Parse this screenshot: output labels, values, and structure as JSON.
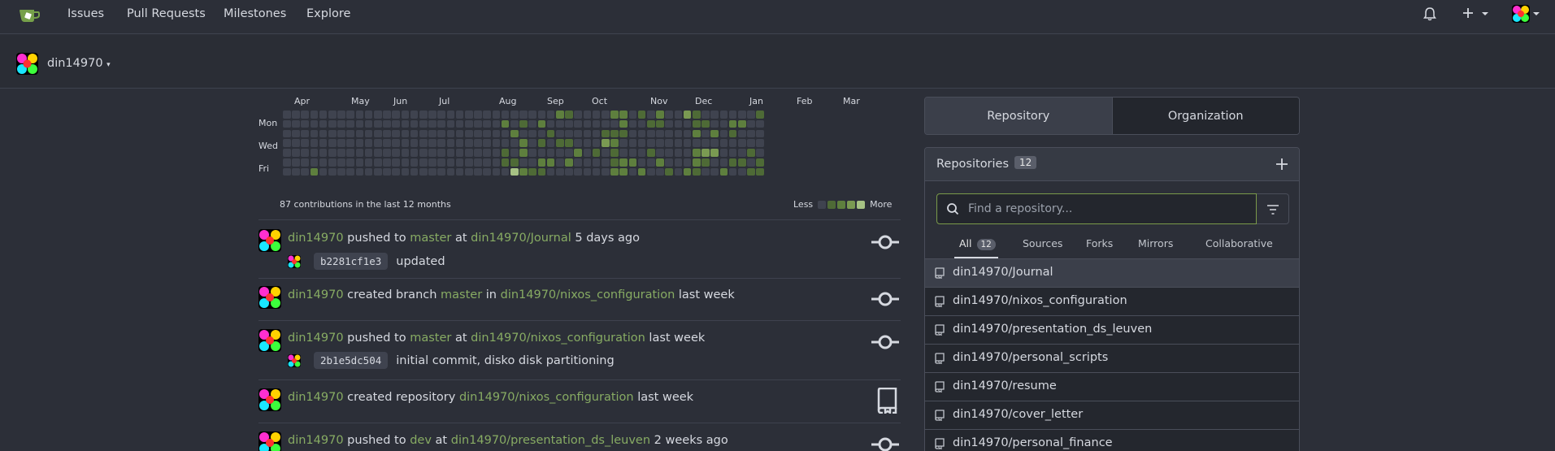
{
  "nav": {
    "links": [
      "Issues",
      "Pull Requests",
      "Milestones",
      "Explore"
    ]
  },
  "user": {
    "name": "din14970"
  },
  "heatmap": {
    "months": [
      "Apr",
      "May",
      "Jun",
      "Jul",
      "Aug",
      "Sep",
      "Oct",
      "Nov",
      "Dec",
      "Jan",
      "Feb",
      "Mar"
    ],
    "days": [
      "Mon",
      "Wed",
      "Fri"
    ],
    "summary": "87 contributions in the last 12 months",
    "legend_less": "Less",
    "legend_more": "More",
    "colors": [
      "#3f434f",
      "#4e6a36",
      "#5e7f3e",
      "#7a9a52",
      "#a6c284"
    ]
  },
  "feed": [
    {
      "user": "din14970",
      "action": "pushed to",
      "ref": "master",
      "prep": "at",
      "repo": "din14970/Journal",
      "time": "5 days ago",
      "sha": "b2281cf1e3",
      "message": "updated",
      "icon": "commit-icon"
    },
    {
      "user": "din14970",
      "action": "created branch",
      "ref": "master",
      "prep": "in",
      "repo": "din14970/nixos_configuration",
      "time": "last week",
      "icon": "commit-icon"
    },
    {
      "user": "din14970",
      "action": "pushed to",
      "ref": "master",
      "prep": "at",
      "repo": "din14970/nixos_configuration",
      "time": "last week",
      "sha": "2b1e5dc504",
      "message": "initial commit, disko disk partitioning",
      "icon": "commit-icon"
    },
    {
      "user": "din14970",
      "action": "created repository",
      "repo": "din14970/nixos_configuration",
      "time": "last week",
      "icon": "repo-icon"
    },
    {
      "user": "din14970",
      "action": "pushed to",
      "ref": "dev",
      "prep": "at",
      "repo": "din14970/presentation_ds_leuven",
      "time": "2 weeks ago",
      "icon": "commit-icon"
    }
  ],
  "right": {
    "tabs": [
      "Repository",
      "Organization"
    ],
    "title": "Repositories",
    "count": "12",
    "search_placeholder": "Find a repository...",
    "filters": [
      "All",
      "Sources",
      "Forks",
      "Mirrors",
      "Collaborative"
    ],
    "all_count": "12",
    "repos": [
      "din14970/Journal",
      "din14970/nixos_configuration",
      "din14970/presentation_ds_leuven",
      "din14970/personal_scripts",
      "din14970/resume",
      "din14970/cover_letter",
      "din14970/personal_finance"
    ]
  }
}
